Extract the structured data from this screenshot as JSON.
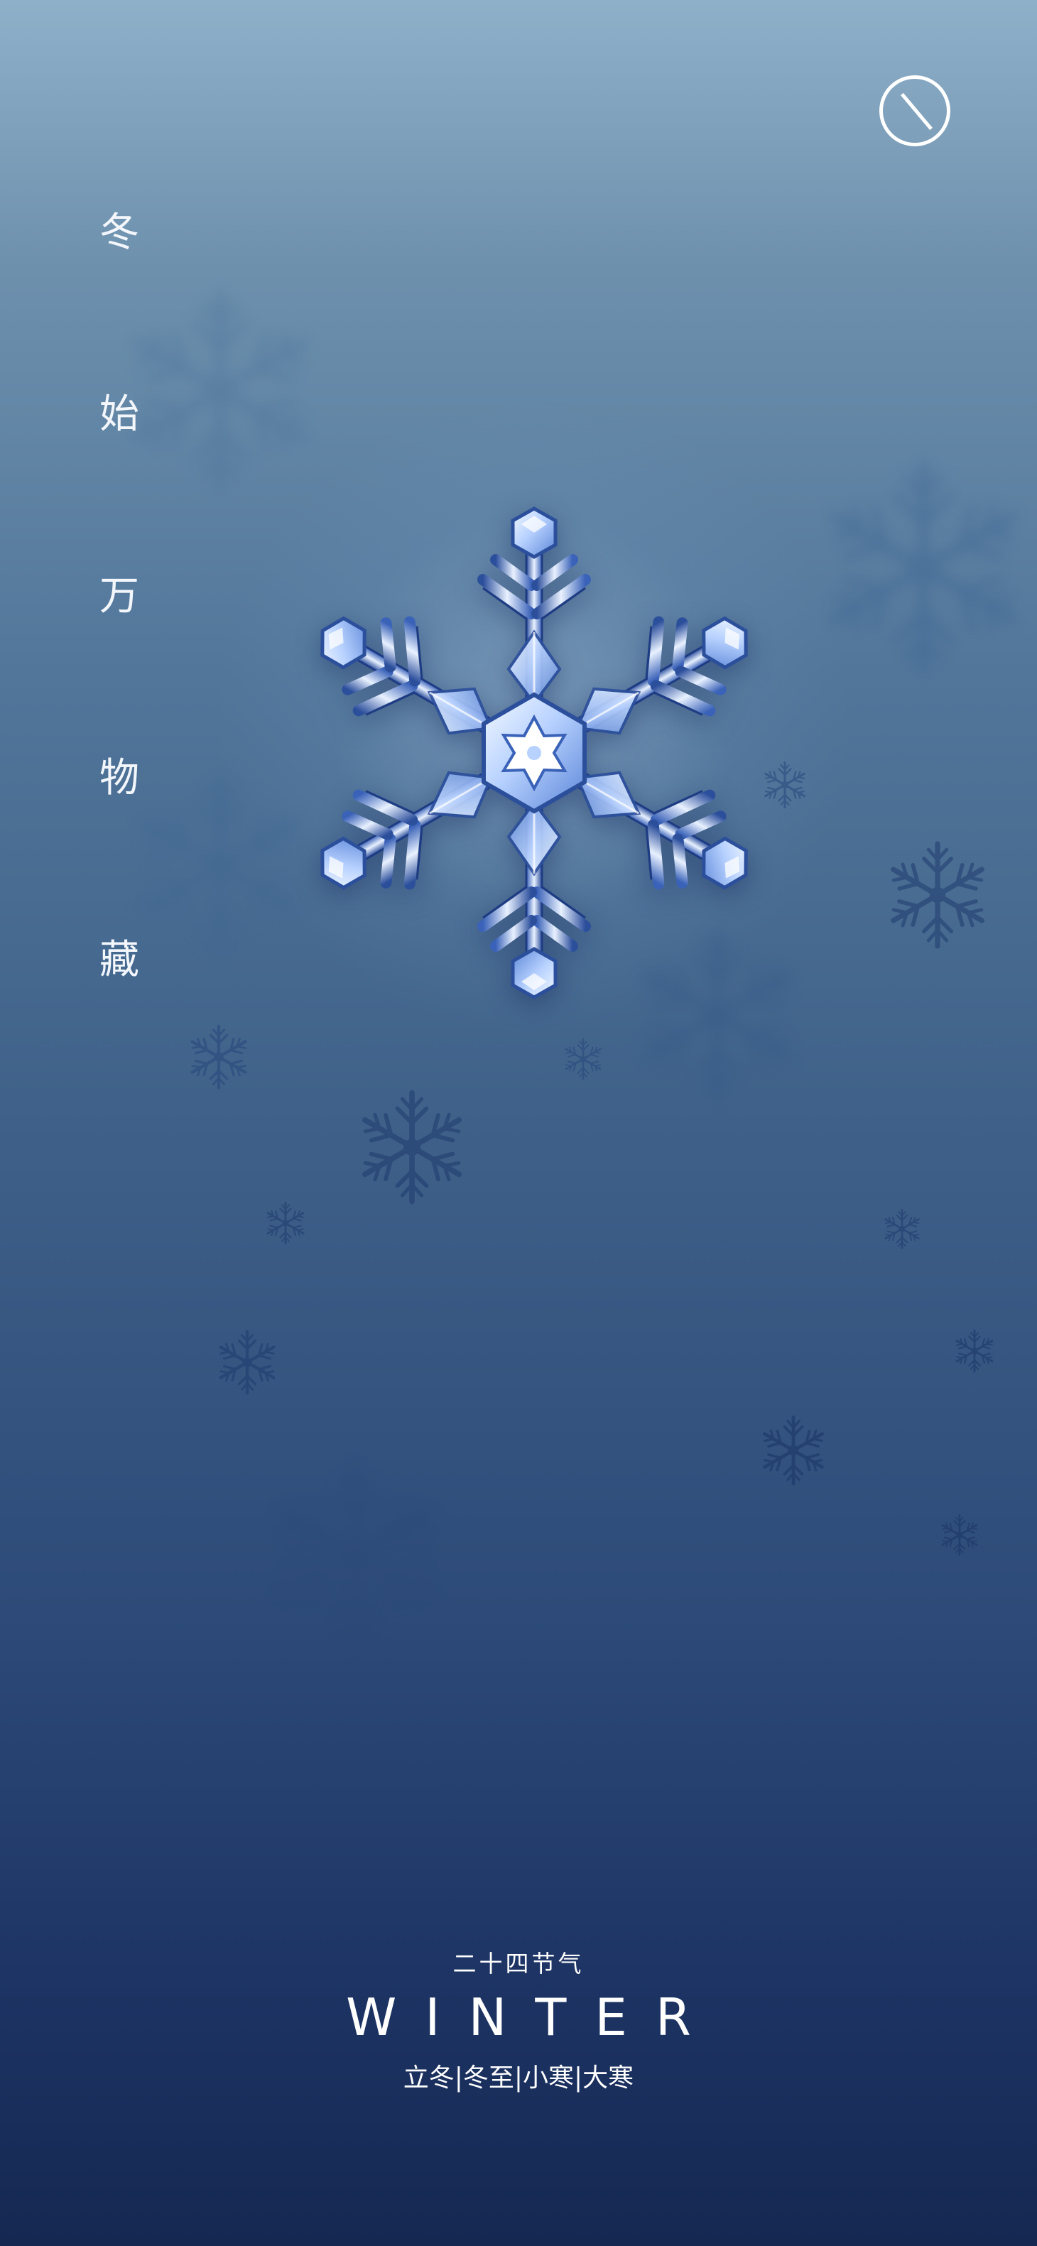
{
  "poster": {
    "slogan": [
      "冬",
      "始",
      "万",
      "物",
      "藏"
    ],
    "subtitle": "二十四节气",
    "title": "WINTER",
    "solar_terms": "立冬|冬至|小寒|大寒"
  },
  "icons": {
    "corner_button": "no-sign-icon",
    "hero": "snowflake-icon"
  },
  "colors": {
    "background_top": "#8fb0c9",
    "background_bottom": "#152852",
    "text": "#ffffff",
    "snowflake_light": "#dbe9ff",
    "snowflake_dark": "#2c4f9c"
  }
}
